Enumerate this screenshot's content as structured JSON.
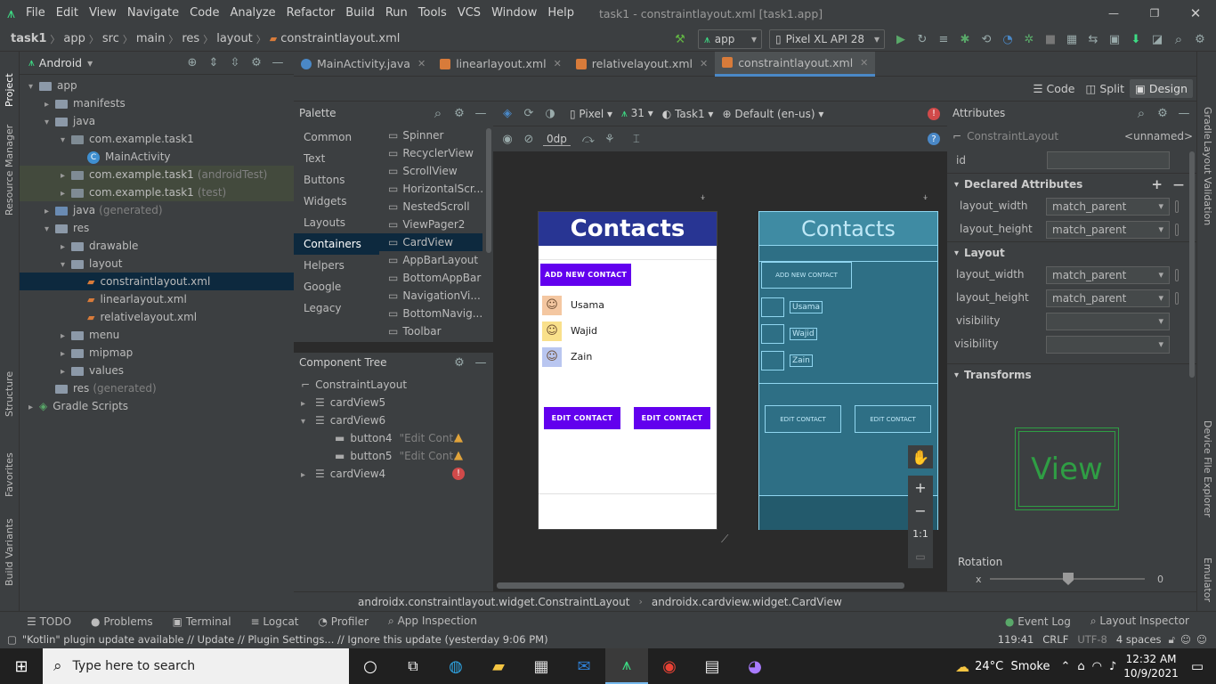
{
  "menubar": {
    "items": [
      "File",
      "Edit",
      "View",
      "Navigate",
      "Code",
      "Analyze",
      "Refactor",
      "Build",
      "Run",
      "Tools",
      "VCS",
      "Window",
      "Help"
    ],
    "title": "task1 - constraintlayout.xml [task1.app]"
  },
  "nav": {
    "crumbs": [
      "task1",
      "app",
      "src",
      "main",
      "res",
      "layout",
      "constraintlayout.xml"
    ],
    "run_config": "app",
    "device": "Pixel XL API 28"
  },
  "project": {
    "view": "Android",
    "tree": [
      {
        "label": "app",
        "depth": 0,
        "arrow": "▾",
        "kind": "folder"
      },
      {
        "label": "manifests",
        "depth": 1,
        "arrow": "▸",
        "kind": "folder"
      },
      {
        "label": "java",
        "depth": 1,
        "arrow": "▾",
        "kind": "folder"
      },
      {
        "label": "com.example.task1",
        "depth": 2,
        "arrow": "▾",
        "kind": "pkg"
      },
      {
        "label": "MainActivity",
        "depth": 3,
        "arrow": "",
        "kind": "class"
      },
      {
        "label": "com.example.task1",
        "suffix": "(androidTest)",
        "depth": 2,
        "arrow": "▸",
        "kind": "pkg",
        "hl": true
      },
      {
        "label": "com.example.task1",
        "suffix": "(test)",
        "depth": 2,
        "arrow": "▸",
        "kind": "pkg",
        "hl": true
      },
      {
        "label": "java",
        "suffix": "(generated)",
        "depth": 1,
        "arrow": "▸",
        "kind": "folder"
      },
      {
        "label": "res",
        "depth": 1,
        "arrow": "▾",
        "kind": "folder"
      },
      {
        "label": "drawable",
        "depth": 2,
        "arrow": "▸",
        "kind": "folder"
      },
      {
        "label": "layout",
        "depth": 2,
        "arrow": "▾",
        "kind": "folder"
      },
      {
        "label": "constraintlayout.xml",
        "depth": 3,
        "arrow": "",
        "kind": "xml",
        "selected": true
      },
      {
        "label": "linearlayout.xml",
        "depth": 3,
        "arrow": "",
        "kind": "xml"
      },
      {
        "label": "relativelayout.xml",
        "depth": 3,
        "arrow": "",
        "kind": "xml"
      },
      {
        "label": "menu",
        "depth": 2,
        "arrow": "▸",
        "kind": "folder"
      },
      {
        "label": "mipmap",
        "depth": 2,
        "arrow": "▸",
        "kind": "folder"
      },
      {
        "label": "values",
        "depth": 2,
        "arrow": "▸",
        "kind": "folder"
      },
      {
        "label": "res",
        "suffix": "(generated)",
        "depth": 1,
        "arrow": "",
        "kind": "folder"
      },
      {
        "label": "Gradle Scripts",
        "depth": 0,
        "arrow": "▸",
        "kind": "gradle"
      }
    ]
  },
  "left_tool": [
    "Project",
    "Resource Manager",
    "Structure",
    "Favorites",
    "Build Variants"
  ],
  "right_tool": [
    "Gradle",
    "Layout Validation",
    "Device File Explorer",
    "Emulator"
  ],
  "tabs": [
    {
      "label": "MainActivity.java",
      "color": "#4a88c7"
    },
    {
      "label": "linearlayout.xml",
      "color": "#d87b3a"
    },
    {
      "label": "relativelayout.xml",
      "color": "#d87b3a"
    },
    {
      "label": "constraintlayout.xml",
      "color": "#d87b3a",
      "active": true
    }
  ],
  "modes": {
    "code": "Code",
    "split": "Split",
    "design": "Design"
  },
  "palette": {
    "title": "Palette",
    "categories": [
      "Common",
      "Text",
      "Buttons",
      "Widgets",
      "Layouts",
      "Containers",
      "Helpers",
      "Google",
      "Legacy"
    ],
    "selected_category": "Containers",
    "items": [
      "Spinner",
      "RecyclerView",
      "ScrollView",
      "HorizontalScr...",
      "NestedScroll",
      "ViewPager2",
      "CardView",
      "AppBarLayout",
      "BottomAppBar",
      "NavigationVi...",
      "BottomNavig...",
      "Toolbar"
    ],
    "selected_item": "CardView"
  },
  "design_toolbar": {
    "device": "Pixel",
    "api": "31",
    "theme": "Task1",
    "locale": "Default (en-us)",
    "margin": "0dp"
  },
  "component_tree": {
    "title": "Component Tree",
    "root": "ConstraintLayout",
    "nodes": [
      {
        "label": "cardView5",
        "depth": 1,
        "arrow": "▸"
      },
      {
        "label": "cardView6",
        "depth": 1,
        "arrow": "▾"
      },
      {
        "label": "button4",
        "hint": "\"Edit Cont...",
        "depth": 2,
        "badge": "warn"
      },
      {
        "label": "button5",
        "hint": "\"Edit Cont...",
        "depth": 2,
        "badge": "warn"
      },
      {
        "label": "cardView4",
        "depth": 1,
        "arrow": "▸",
        "badge": "error"
      }
    ]
  },
  "preview": {
    "title": "Contacts",
    "add_button": "ADD NEW CONTACT",
    "contacts": [
      "Usama",
      "Wajid",
      "Zain"
    ],
    "edit_button": "EDIT CONTACT",
    "accent": "#6200ee",
    "header": "#283593"
  },
  "zoom": {
    "one_to_one": "1:1"
  },
  "attributes": {
    "title": "Attributes",
    "class": "ConstraintLayout",
    "name": "<unnamed>",
    "id_label": "id",
    "declared": {
      "title": "Declared Attributes",
      "rows": [
        {
          "k": "layout_width",
          "v": "match_parent"
        },
        {
          "k": "layout_height",
          "v": "match_parent"
        }
      ]
    },
    "layout": {
      "title": "Layout",
      "rows": [
        {
          "k": "layout_width",
          "v": "match_parent"
        },
        {
          "k": "layout_height",
          "v": "match_parent"
        },
        {
          "k": "visibility",
          "v": ""
        },
        {
          "k": "visibility",
          "v": ""
        }
      ]
    },
    "transforms": {
      "title": "Transforms",
      "view_label": "View",
      "rotation": "Rotation",
      "axis": "x",
      "value": "0"
    }
  },
  "breadcrumb_bottom": [
    "androidx.constraintlayout.widget.ConstraintLayout",
    "androidx.cardview.widget.CardView"
  ],
  "bottom_tools": [
    "TODO",
    "Problems",
    "Terminal",
    "Logcat",
    "Profiler",
    "App Inspection"
  ],
  "bottom_right": [
    "Event Log",
    "Layout Inspector"
  ],
  "status": {
    "message": "\"Kotlin\" plugin update available // Update // Plugin Settings... // Ignore this update (yesterday 9:06 PM)",
    "position": "119:41",
    "eol": "CRLF",
    "encoding": "UTF-8",
    "indent": "4 spaces"
  },
  "taskbar": {
    "search": "Type here to search",
    "weather": "24°C  Smoke",
    "time": "12:32 AM",
    "date": "10/9/2021"
  }
}
